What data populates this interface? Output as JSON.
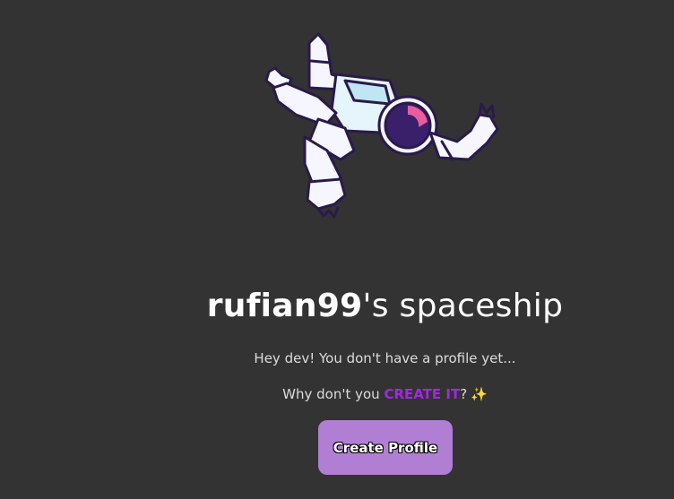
{
  "profile": {
    "username": "rufian99",
    "title_suffix": "'s spaceship",
    "message": "Hey dev! You don't have a profile yet...",
    "prompt_prefix": "Why don't you ",
    "prompt_link": "CREATE IT",
    "prompt_suffix": "?",
    "sparkle": "✨",
    "create_button": "Create Profile"
  },
  "colors": {
    "background": "#333333",
    "accent": "#a526e8",
    "button": "#b07fd4"
  },
  "icons": {
    "illustration": "astronaut-illustration"
  }
}
